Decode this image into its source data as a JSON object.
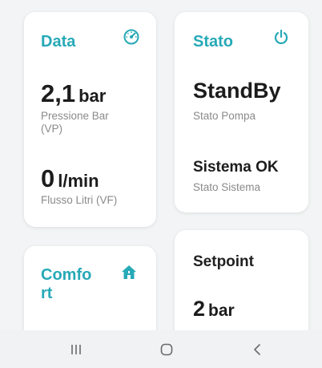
{
  "cards": {
    "data": {
      "title": "Data",
      "icon": "speedometer-icon",
      "pressure_value": "2,1",
      "pressure_unit": "bar",
      "pressure_label": "Pressione Bar (VP)",
      "flow_value": "0",
      "flow_unit": "l/min",
      "flow_label": "Flusso Litri (VF)"
    },
    "stato": {
      "title": "Stato",
      "icon": "power-icon",
      "pump_state": "StandBy",
      "pump_label": "Stato Pompa",
      "system_state": "Sistema OK",
      "system_label": "Stato Sistema"
    },
    "comfort": {
      "title_line1": "Comfo",
      "title_line2": "rt",
      "icon": "home-icon"
    },
    "setpoint": {
      "title": "Setpoint",
      "value": "2",
      "unit": "bar"
    }
  },
  "navbar": {
    "recent_icon": "recent-apps-icon",
    "home_icon": "home-nav-icon",
    "back_icon": "back-icon"
  },
  "colors": {
    "accent": "#27a9b7",
    "text_dark": "#1c1c1c",
    "text_muted": "#8a8a8a",
    "background": "#f3f4f5"
  }
}
